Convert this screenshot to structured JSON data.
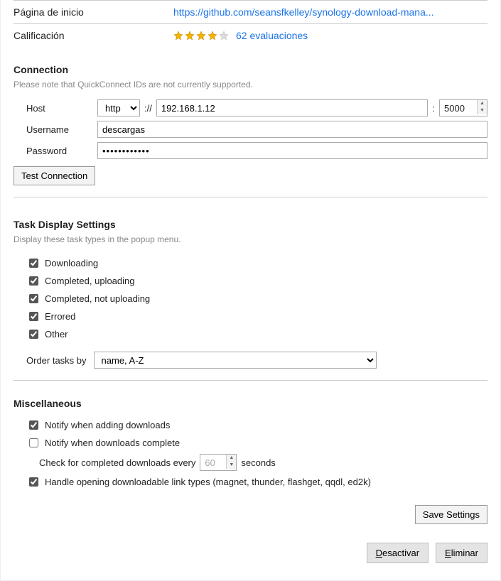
{
  "meta": {
    "homepage_label": "Página de inicio",
    "homepage_url": "https://github.com/seansfkelley/synology-download-mana...",
    "rating_label": "Calificación",
    "rating_stars": 4,
    "rating_text": "62 evaluaciones"
  },
  "connection": {
    "title": "Connection",
    "desc": "Please note that QuickConnect IDs are not currently supported.",
    "host_label": "Host",
    "protocol": "http",
    "sep": "://",
    "host_value": "192.168.1.12",
    "port_sep": ":",
    "port_value": "5000",
    "username_label": "Username",
    "username_value": "descargas",
    "password_label": "Password",
    "password_value": "••••••••••••",
    "test_button": "Test Connection"
  },
  "task_display": {
    "title": "Task Display Settings",
    "desc": "Display these task types in the popup menu.",
    "downloading": "Downloading",
    "completed_uploading": "Completed, uploading",
    "completed_not_uploading": "Completed, not uploading",
    "errored": "Errored",
    "other": "Other",
    "order_label": "Order tasks by",
    "order_value": "name, A-Z"
  },
  "misc": {
    "title": "Miscellaneous",
    "notify_adding": "Notify when adding downloads",
    "notify_complete": "Notify when downloads complete",
    "interval_prefix": "Check for completed downloads every",
    "interval_value": "60",
    "interval_suffix": "seconds",
    "handle_links": "Handle opening downloadable link types (magnet, thunder, flashget, qqdl, ed2k)"
  },
  "buttons": {
    "save": "Save Settings",
    "deactivate_first": "D",
    "deactivate_rest": "esactivar",
    "remove_first": "E",
    "remove_rest": "liminar"
  }
}
